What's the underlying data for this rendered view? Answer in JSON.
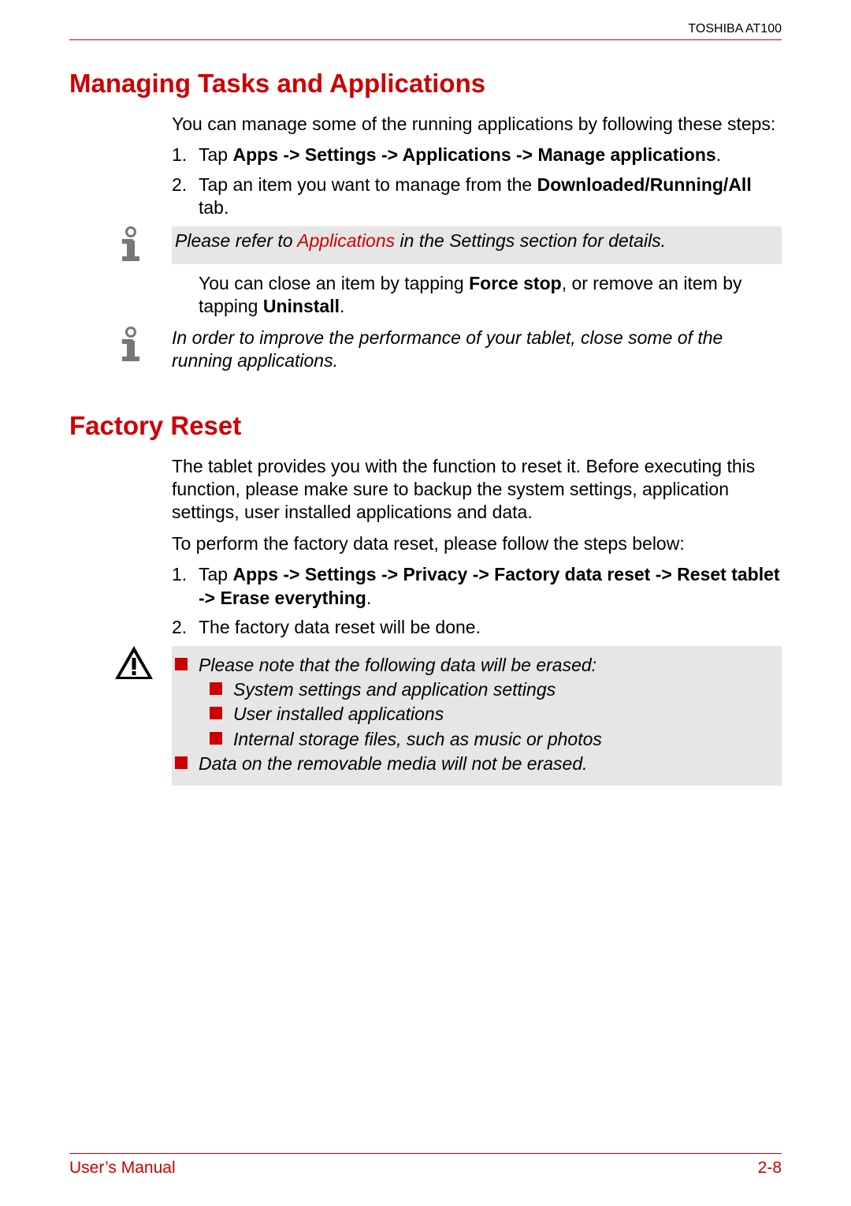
{
  "header": {
    "product": "TOSHIBA AT100"
  },
  "section1": {
    "title": "Managing Tasks and Applications",
    "intro": "You can manage some of the running applications by following these steps:",
    "step1_pre": "Tap ",
    "step1_bold": "Apps -> Settings -> Applications -> Manage applications",
    "step1_post": ".",
    "step2_pre": "Tap an item you want to manage from the ",
    "step2_bold": "Downloaded/Running/All",
    "step2_post": " tab.",
    "note1_pre": "Please refer to ",
    "note1_link": "Applications",
    "note1_post": " in the Settings section for details.",
    "after_note_pre": "You can close an item by tapping ",
    "after_note_b1": "Force stop",
    "after_note_mid": ", or remove an item by tapping ",
    "after_note_b2": "Uninstall",
    "after_note_post": ".",
    "note2": "In order to improve the performance of your tablet, close some of the running applications."
  },
  "section2": {
    "title": "Factory Reset",
    "intro": "The tablet provides you with the function to reset it. Before executing this function, please make sure to backup the system settings, application settings, user installed applications and data.",
    "lead": "To perform the factory data reset, please follow the steps below:",
    "step1_pre": "Tap ",
    "step1_bold": "Apps -> Settings -> Privacy -> Factory data reset -> Reset tablet -> Erase everything",
    "step1_post": ".",
    "step2": "The factory data reset will be done.",
    "warn_intro": "Please note that the following data will be erased:",
    "warn_items": [
      "System settings and application settings",
      "User installed applications",
      "Internal storage files, such as music or photos"
    ],
    "warn_outro": "Data on the removable media will not be erased."
  },
  "footer": {
    "left": "User’s Manual",
    "right": "2-8"
  },
  "nums": {
    "one": "1.",
    "two": "2."
  }
}
